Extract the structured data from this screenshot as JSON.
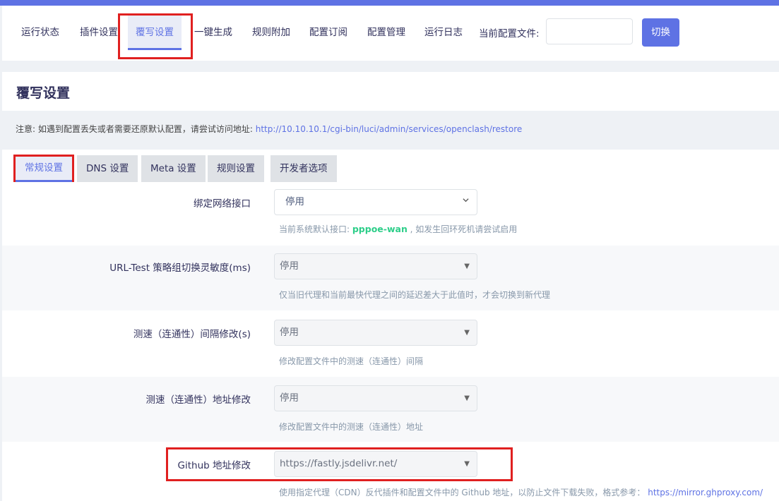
{
  "nav": {
    "items": [
      "运行状态",
      "插件设置",
      "覆写设置",
      "一键生成",
      "规则附加",
      "配置订阅",
      "配置管理",
      "运行日志"
    ],
    "current_config_label": "当前配置文件:",
    "current_config_value": "",
    "switch_label": "切换"
  },
  "page": {
    "title": "覆写设置",
    "notice_prefix": "注意: 如遇到配置丢失或者需要还原默认配置，请尝试访问地址: ",
    "notice_link": "http://10.10.10.1/cgi-bin/luci/admin/services/openclash/restore"
  },
  "tabs": [
    "常规设置",
    "DNS 设置",
    "Meta 设置",
    "规则设置",
    "开发者选项"
  ],
  "settings": {
    "bind_interface": {
      "label": "绑定网络接口",
      "value": "停用",
      "hint_prefix": "当前系统默认接口: ",
      "hint_value": "pppoe-wan",
      "hint_suffix": " , 如发生回环死机请尝试启用"
    },
    "url_test": {
      "label": "URL-Test 策略组切换灵敏度(ms)",
      "value": "停用",
      "hint": "仅当旧代理和当前最快代理之间的延迟差大于此值时，才会切换到新代理"
    },
    "speed_interval": {
      "label": "测速（连通性）间隔修改(s)",
      "value": "停用",
      "hint": "修改配置文件中的测速（连通性）间隔"
    },
    "speed_url": {
      "label": "测速（连通性）地址修改",
      "value": "停用",
      "hint": "修改配置文件中的测速（连通性）地址"
    },
    "github": {
      "label": "Github 地址修改",
      "value": "https://fastly.jsdelivr.net/",
      "hint_prefix": "使用指定代理（CDN）反代插件和配置文件中的 Github 地址，以防止文件下载失败，格式参考： ",
      "hint_link": "https://mirror.ghproxy.com/"
    }
  },
  "colors": {
    "accent": "#5e72e4",
    "highlight_box": "#e02020",
    "interface_name": "#2dce89"
  }
}
